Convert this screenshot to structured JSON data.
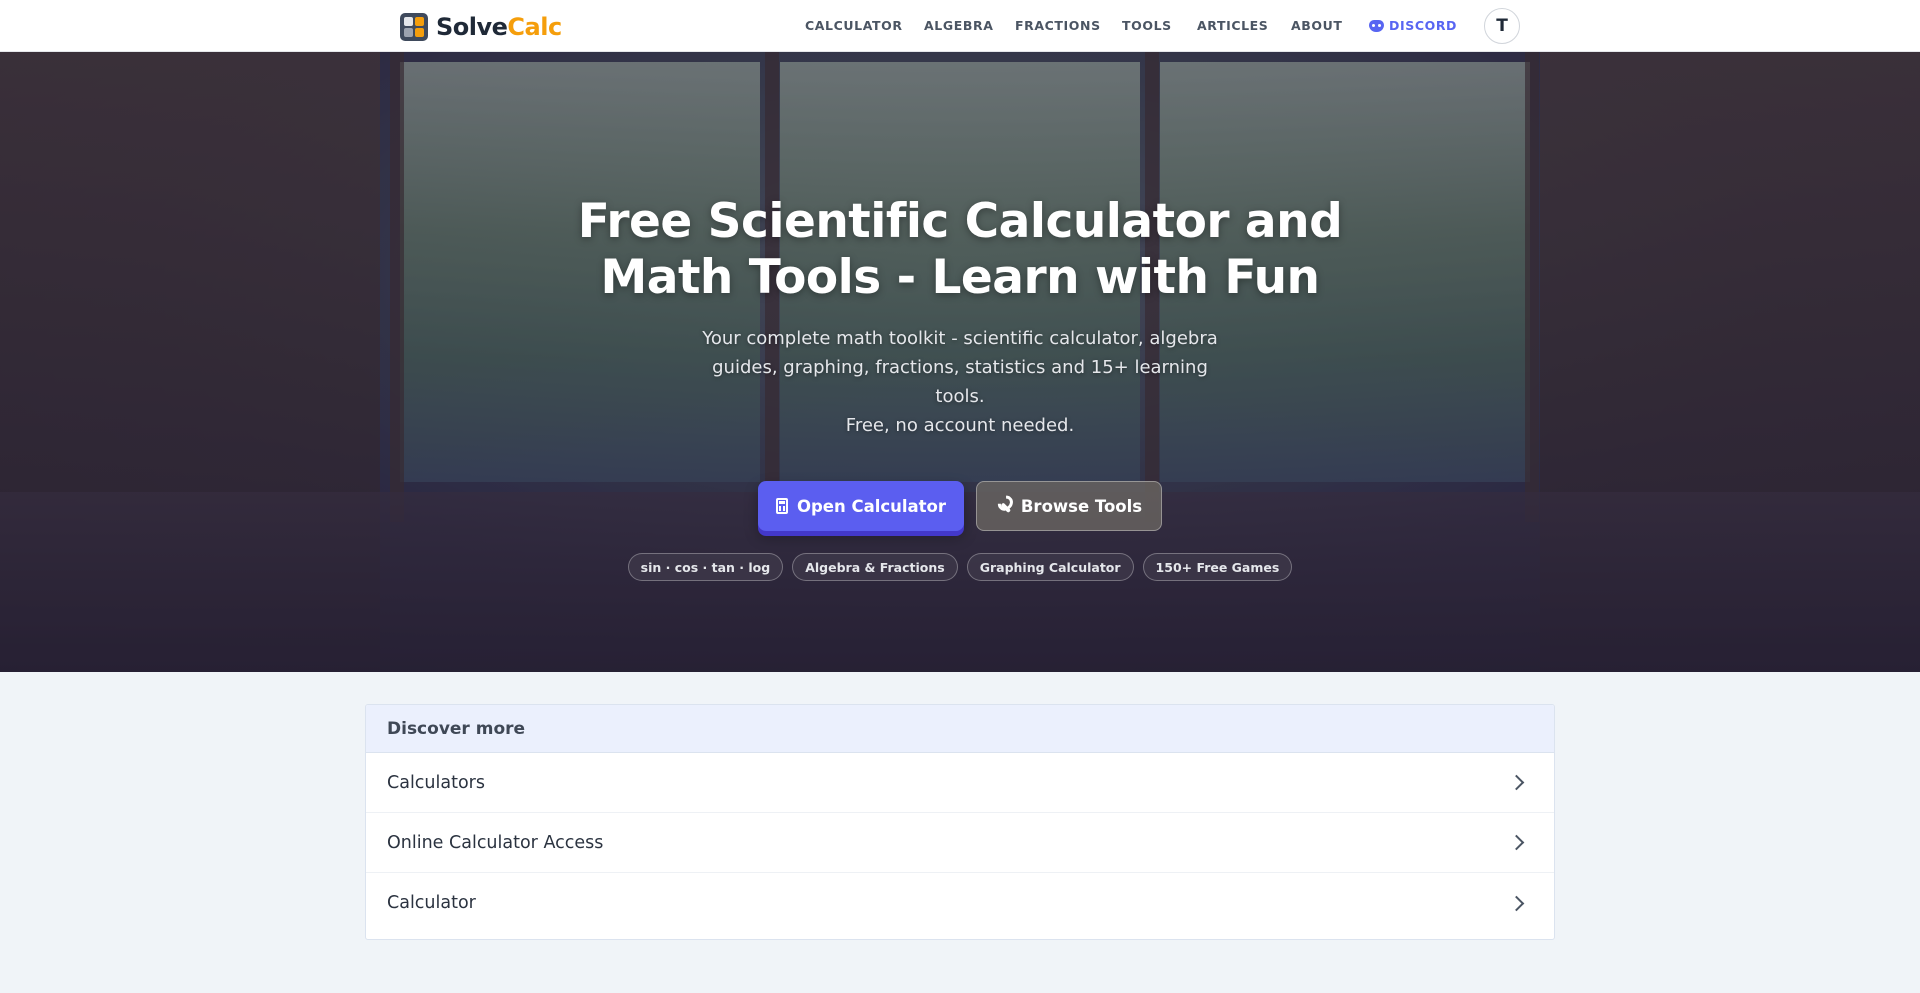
{
  "brand": {
    "name_part1": "Solve",
    "name_part2": "Calc"
  },
  "nav": {
    "items": [
      {
        "label": "CALCULATOR"
      },
      {
        "label": "ALGEBRA"
      },
      {
        "label": "FRACTIONS"
      },
      {
        "label": "TOOLS"
      },
      {
        "label": "ARTICLES"
      },
      {
        "label": "ABOUT"
      }
    ],
    "discord_label": "DISCORD",
    "avatar_initial": "T"
  },
  "hero": {
    "title_line1": "Free Scientific Calculator and",
    "title_line2": "Math Tools - Learn with Fun",
    "subtitle_line1": "Your complete math toolkit - scientific calculator, algebra",
    "subtitle_line2": "guides, graphing, fractions, statistics and 15+ learning tools.",
    "subtitle_line3": "Free, no account needed.",
    "primary_button": "Open Calculator",
    "secondary_button": "Browse Tools",
    "chips": [
      "sin · cos · tan · log",
      "Algebra & Fractions",
      "Graphing Calculator",
      "150+ Free Games"
    ]
  },
  "discover": {
    "heading": "Discover more",
    "items": [
      {
        "label": "Calculators"
      },
      {
        "label": "Online Calculator Access"
      },
      {
        "label": "Calculator"
      }
    ]
  },
  "colors": {
    "accent": "#5b5ef0",
    "brand_orange": "#f59e0b",
    "discord": "#5865f2",
    "page_bg": "#f0f4f8"
  },
  "icons": [
    "logo-calculator-icon",
    "discord-icon",
    "calculator-icon",
    "wrench-icon",
    "chevron-right-icon"
  ]
}
